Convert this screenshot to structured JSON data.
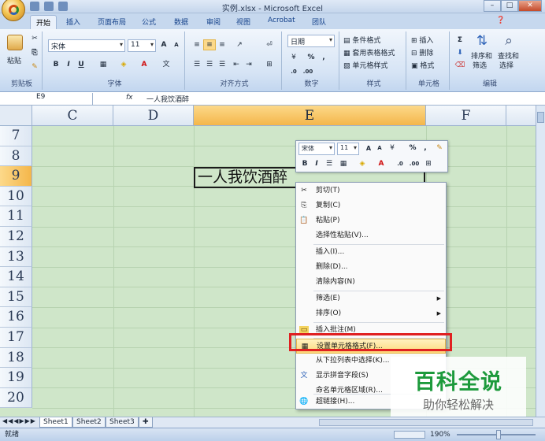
{
  "window": {
    "title": "实例.xlsx - Microsoft Excel"
  },
  "tabs": [
    "开始",
    "插入",
    "页面布局",
    "公式",
    "数据",
    "审阅",
    "视图",
    "Acrobat",
    "团队"
  ],
  "ribbon": {
    "clipboard": {
      "paste": "粘贴",
      "label": "剪贴板"
    },
    "font": {
      "name": "宋体",
      "size": "11",
      "bold": "B",
      "italic": "I",
      "underline": "U",
      "label": "字体",
      "grow": "A",
      "shrink": "A"
    },
    "alignment": {
      "label": "对齐方式"
    },
    "number": {
      "format": "日期",
      "percent": "%",
      "comma": ",",
      "label": "数字"
    },
    "styles": {
      "conditional": "条件格式",
      "table": "套用表格格式",
      "cell": "单元格样式",
      "label": "样式"
    },
    "cells": {
      "insert": "插入",
      "delete": "删除",
      "format": "格式",
      "label": "单元格"
    },
    "editing": {
      "sigma": "Σ",
      "sort": "排序和",
      "sort2": "筛选",
      "find": "查找和",
      "find2": "选择",
      "label": "编辑"
    }
  },
  "formula_bar": {
    "cell_ref": "E9",
    "fx": "fx",
    "value": "一人我饮酒醉"
  },
  "grid": {
    "columns": [
      "C",
      "D",
      "E",
      "F"
    ],
    "rows": [
      "7",
      "8",
      "9",
      "10",
      "11",
      "12",
      "13",
      "14",
      "15",
      "16",
      "17",
      "18",
      "19",
      "20"
    ],
    "cell_E9": "一人我饮酒醉"
  },
  "mini_toolbar": {
    "font": "宋体",
    "size": "11",
    "bold": "B",
    "italic": "I",
    "percent": "%",
    "comma": ","
  },
  "context_menu": {
    "items": [
      {
        "label": "剪切(T)",
        "icon": "✂"
      },
      {
        "label": "复制(C)",
        "icon": "⎘"
      },
      {
        "label": "粘贴(P)",
        "icon": "📋"
      },
      {
        "label": "选择性粘贴(V)...",
        "icon": ""
      },
      {
        "label": "插入(I)...",
        "icon": ""
      },
      {
        "label": "删除(D)...",
        "icon": ""
      },
      {
        "label": "清除内容(N)",
        "icon": ""
      },
      {
        "label": "筛选(E)",
        "icon": ""
      },
      {
        "label": "排序(O)",
        "icon": ""
      },
      {
        "label": "插入批注(M)",
        "icon": "▭"
      },
      {
        "label": "设置单元格格式(F)...",
        "icon": "▦"
      },
      {
        "label": "从下拉列表中选择(K)...",
        "icon": ""
      },
      {
        "label": "显示拼音字段(S)",
        "icon": "文"
      },
      {
        "label": "命名单元格区域(R)...",
        "icon": ""
      },
      {
        "label": "超链接(H)...",
        "icon": "🌐"
      }
    ]
  },
  "sheets": [
    "Sheet1",
    "Sheet2",
    "Sheet3"
  ],
  "status": {
    "mode": "就绪",
    "zoom": "190%"
  },
  "watermark": {
    "title": "百科全说",
    "subtitle": "助你轻松解决"
  },
  "colors": {
    "accent": "#f4b64a",
    "highlight": "#fed87a",
    "red_box": "#e02020",
    "grid_bg": "#cfe6c9"
  }
}
